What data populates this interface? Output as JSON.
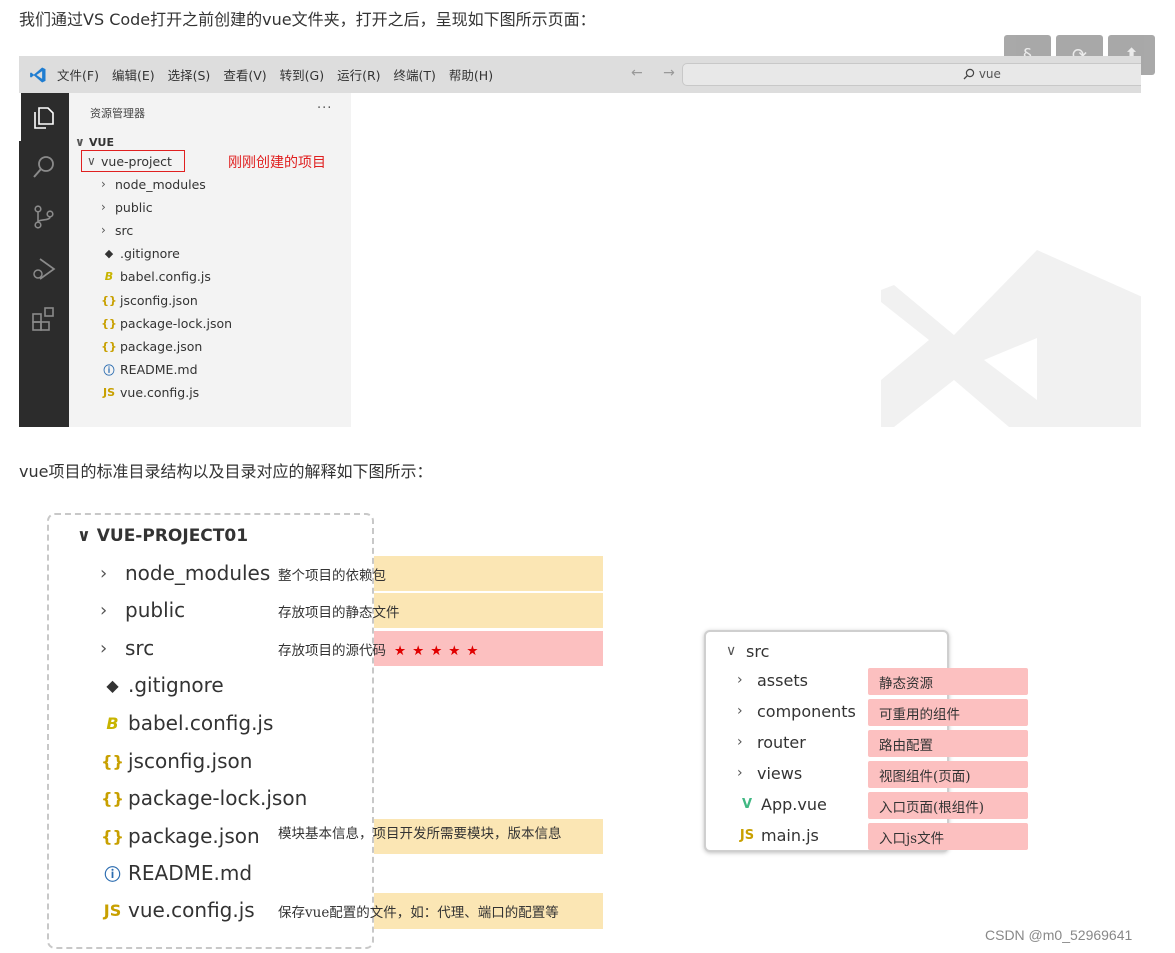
{
  "paragraphs": {
    "p1": "我们通过VS Code打开之前创建的vue文件夹，打开之后，呈现如下图所示页面：",
    "p2": "vue项目的标准目录结构以及目录对应的解释如下图所示："
  },
  "floating_buttons": [
    "§",
    "⟳",
    "⬆"
  ],
  "vscode": {
    "menu": [
      "文件(F)",
      "编辑(E)",
      "选择(S)",
      "查看(V)",
      "转到(G)",
      "运行(R)",
      "终端(T)",
      "帮助(H)"
    ],
    "nav_arrows": "← →",
    "search_label": "vue",
    "sidebar_title": "资源管理器",
    "sidebar_more": "···",
    "root_folder": "VUE",
    "project_folder": "vue-project",
    "annotation": "刚刚创建的项目",
    "items": [
      {
        "name": "node_modules",
        "kind": "folder"
      },
      {
        "name": "public",
        "kind": "folder"
      },
      {
        "name": "src",
        "kind": "folder"
      },
      {
        "name": ".gitignore",
        "kind": "git"
      },
      {
        "name": "babel.config.js",
        "kind": "babel"
      },
      {
        "name": "jsconfig.json",
        "kind": "json"
      },
      {
        "name": "package-lock.json",
        "kind": "json"
      },
      {
        "name": "package.json",
        "kind": "json"
      },
      {
        "name": "README.md",
        "kind": "info"
      },
      {
        "name": "vue.config.js",
        "kind": "js"
      }
    ],
    "icon_glyphs": {
      "folder": "",
      "git": "◆",
      "babel": "B",
      "json": "{}",
      "info": "ⓘ",
      "js": "JS"
    }
  },
  "diagram1": {
    "root": "VUE-PROJECT01",
    "rows": [
      {
        "name": "node_modules",
        "kind": "folder",
        "desc": "整个项目的依赖包",
        "band": "yellow"
      },
      {
        "name": "public",
        "kind": "folder",
        "desc": "存放项目的静态文件",
        "band": "yellow"
      },
      {
        "name": "src",
        "kind": "folder",
        "desc": "存放项目的源代码",
        "band": "pink",
        "stars": "★★★★★"
      },
      {
        "name": ".gitignore",
        "kind": "git",
        "desc": "",
        "band": ""
      },
      {
        "name": "babel.config.js",
        "kind": "babel",
        "desc": "",
        "band": ""
      },
      {
        "name": "jsconfig.json",
        "kind": "json",
        "desc": "",
        "band": ""
      },
      {
        "name": "package-lock.json",
        "kind": "json",
        "desc": "",
        "band": ""
      },
      {
        "name": "package.json",
        "kind": "json",
        "desc": "模块基本信息，项目开发所需要模块，版本信息",
        "band": "yellow"
      },
      {
        "name": "README.md",
        "kind": "info",
        "desc": "",
        "band": ""
      },
      {
        "name": "vue.config.js",
        "kind": "js",
        "desc": "保存vue配置的文件，如：代理、端口的配置等",
        "band": "yellow"
      }
    ]
  },
  "diagram2": {
    "root": "src",
    "rows": [
      {
        "name": "assets",
        "kind": "folder",
        "desc": "静态资源"
      },
      {
        "name": "components",
        "kind": "folder",
        "desc": "可重用的组件"
      },
      {
        "name": "router",
        "kind": "folder",
        "desc": "路由配置"
      },
      {
        "name": "views",
        "kind": "folder",
        "desc": "视图组件(页面)"
      },
      {
        "name": "App.vue",
        "kind": "vue",
        "desc": "入口页面(根组件)"
      },
      {
        "name": "main.js",
        "kind": "js",
        "desc": "入口js文件"
      }
    ]
  },
  "colors": {
    "band_yellow": "#fbe6b4",
    "band_pink": "#fcc0c0",
    "annotation_red": "#e02020",
    "json_icon": "#c8a000",
    "js_icon": "#c8a000",
    "babel_icon": "#c8b400",
    "vue_icon": "#41b883",
    "info_icon": "#2b6cb0"
  },
  "footer": "CSDN @m0_52969641"
}
